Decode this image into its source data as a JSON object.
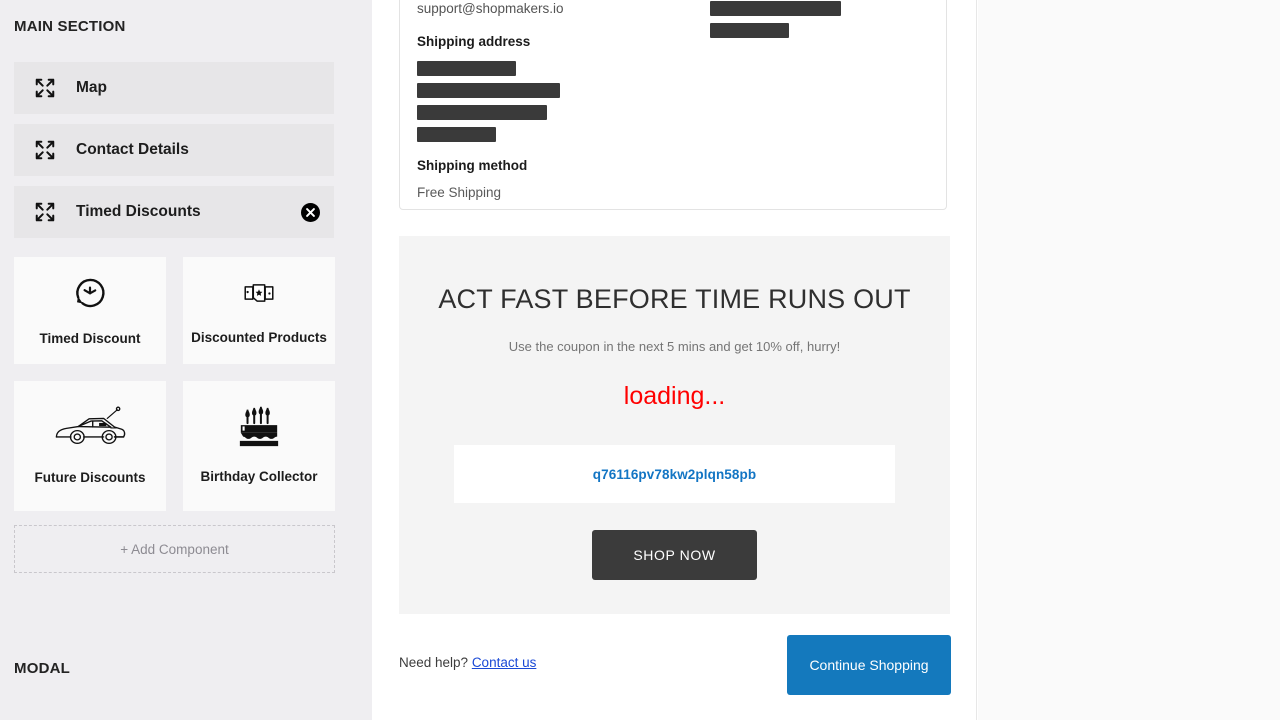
{
  "sidebar": {
    "section_heading": "MAIN SECTION",
    "modal_heading": "MODAL",
    "components": [
      {
        "label": "Map",
        "icon": "move-icon",
        "removable": false
      },
      {
        "label": "Contact Details",
        "icon": "move-icon",
        "removable": false
      },
      {
        "label": "Timed Discounts",
        "icon": "move-icon",
        "removable": true
      }
    ],
    "tiles": [
      {
        "label": "Timed Discount",
        "icon": "clock-rotate-icon"
      },
      {
        "label": "Discounted Products",
        "icon": "discount-cards-icon"
      },
      {
        "label": "Future Discounts",
        "icon": "delorean-car-icon"
      },
      {
        "label": "Birthday Collector",
        "icon": "birthday-cake-icon"
      }
    ],
    "add_component_label": "+ Add Component"
  },
  "order_card": {
    "email": "support@shopmakers.io",
    "shipping_address_heading": "Shipping address",
    "shipping_method_heading": "Shipping method",
    "shipping_method_value": "Free Shipping",
    "redacted_left_widths": [
      99,
      143,
      130,
      79
    ],
    "redacted_right_widths": [
      101,
      144,
      131,
      79
    ]
  },
  "promo": {
    "title": "ACT FAST BEFORE TIME RUNS OUT",
    "subtitle": "Use the coupon in the next 5 mins and get 10% off, hurry!",
    "countdown": "loading...",
    "coupon_code": "q76116pv78kw2plqn58pb",
    "shop_now_label": "SHOP NOW"
  },
  "footer": {
    "help_prefix": "Need help? ",
    "contact_label": "Contact us",
    "continue_label": "Continue Shopping"
  },
  "colors": {
    "sidebar_bg": "#efeef1",
    "row_bg": "#e7e6e8",
    "tile_bg": "#fafafa",
    "promo_bg": "#f4f4f4",
    "countdown_red": "#ff0000",
    "coupon_blue": "#1275c4",
    "link_blue": "#1a49d6",
    "primary_blue": "#1479bd",
    "dark_button": "#3b3b3b",
    "redact_dark": "#3a3a3a"
  }
}
